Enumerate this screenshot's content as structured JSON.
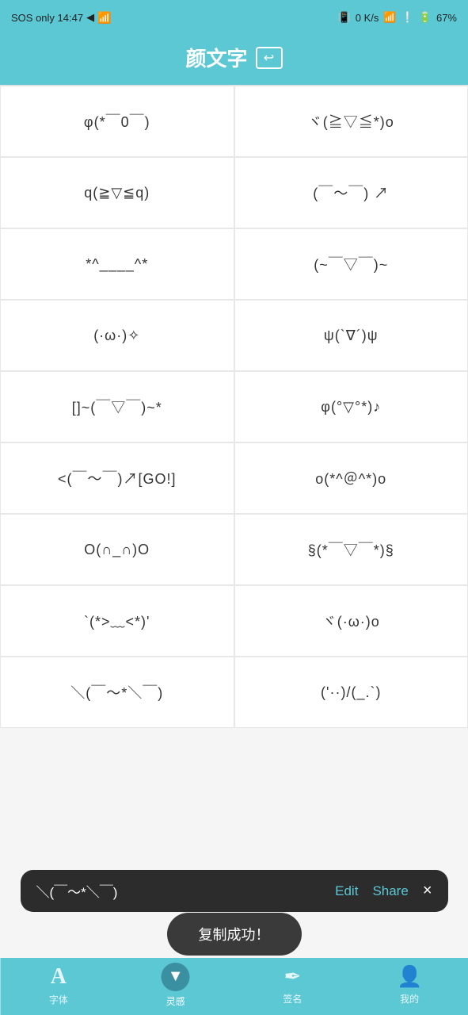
{
  "statusBar": {
    "left": "SOS only  14:47",
    "signal": "📶",
    "ks": "0 K/s",
    "wifi": "wifi",
    "battery": "67%"
  },
  "header": {
    "title": "颜文字",
    "iconSymbol": "⬛"
  },
  "emojis": [
    "φ(*￣0￣)",
    "ヾ(≧▽≦*)o",
    "q(≧▽≦q)",
    "(￣～￣) ↗",
    "*^____^*",
    "(~￣▽￣)~",
    "(·ω·)✧",
    "ψ(`∇´)ψ",
    "[]~(￣▽￣)~*",
    "φ(°▽°*)♪",
    "<(￣～￣)↗[GO!]",
    "o(*^＠^*)o",
    "O(∩_∩)O",
    "§(*￣▽￣*)§",
    "`(*>﹏<*)'",
    "ヾ(·ω·)o",
    "＼(￣～*＼￣)",
    "('··)/(_.`)"
  ],
  "popupBar": {
    "text": "＼(￣～*＼￣)",
    "editLabel": "Edit",
    "shareLabel": "Share",
    "closeIcon": "×"
  },
  "toast": {
    "text": "复制成功！"
  },
  "bottomNav": {
    "items": [
      {
        "label": "字体",
        "icon": "A",
        "active": false
      },
      {
        "label": "灵感",
        "icon": "💡",
        "active": true
      },
      {
        "label": "签名",
        "icon": "✏️",
        "active": false
      },
      {
        "label": "我的",
        "icon": "👤",
        "active": false
      }
    ]
  }
}
